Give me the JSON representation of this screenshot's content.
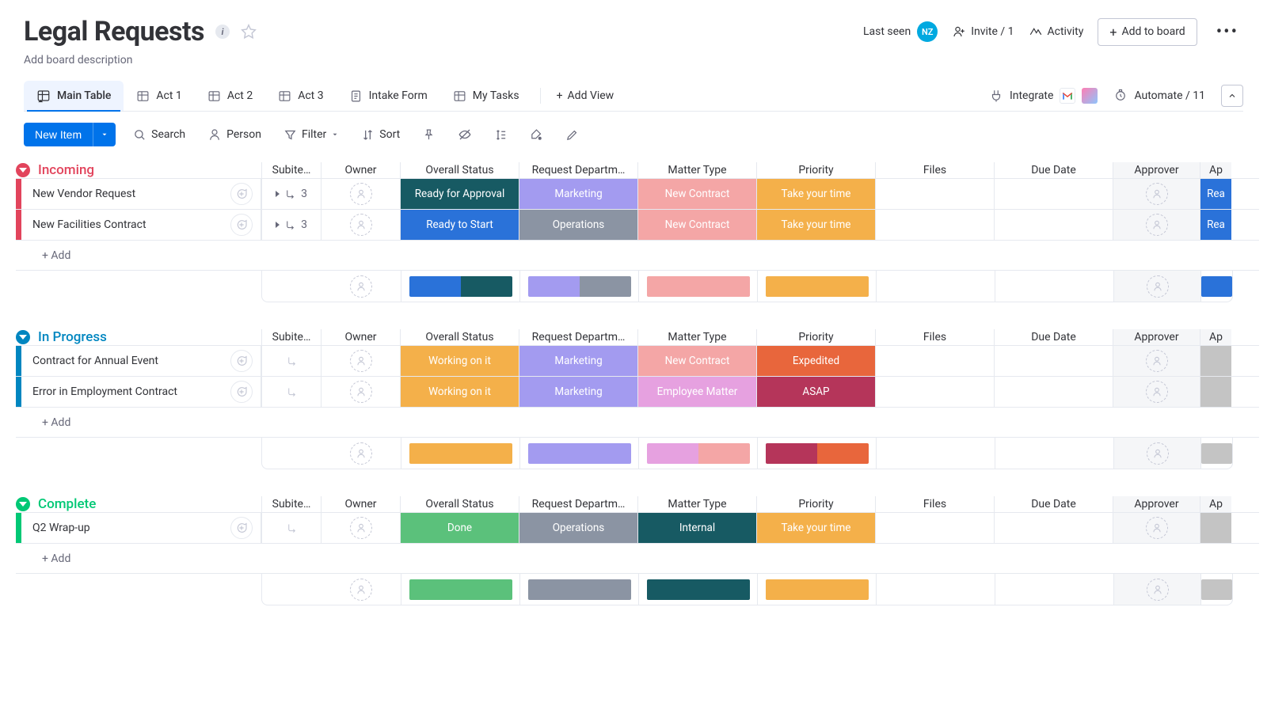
{
  "header": {
    "title": "Legal Requests",
    "description": "Add board description",
    "last_seen": "Last seen",
    "avatar_initials": "NZ",
    "invite": "Invite / 1",
    "activity": "Activity",
    "add_to_board": "Add to board"
  },
  "tabs": {
    "items": [
      {
        "label": "Main Table",
        "icon": "table-home"
      },
      {
        "label": "Act 1",
        "icon": "table"
      },
      {
        "label": "Act 2",
        "icon": "table"
      },
      {
        "label": "Act 3",
        "icon": "table"
      },
      {
        "label": "Intake Form",
        "icon": "form"
      },
      {
        "label": "My Tasks",
        "icon": "table"
      }
    ],
    "add_view": "Add View",
    "integrate": "Integrate",
    "automate": "Automate / 11"
  },
  "toolbar": {
    "new_item": "New Item",
    "search": "Search",
    "person": "Person",
    "filter": "Filter",
    "sort": "Sort"
  },
  "columns": [
    "Subite…",
    "Owner",
    "Overall Status",
    "Request Departm…",
    "Matter Type",
    "Priority",
    "Files",
    "Due Date",
    "Approver",
    "Ap"
  ],
  "groups": [
    {
      "name": "Incoming",
      "color": "#e2445c",
      "text_color": "#e2445c",
      "rows": [
        {
          "name": "New Vendor Request",
          "sub_count": "3",
          "sub_expand": true,
          "status": {
            "label": "Ready for Approval",
            "bg": "#175a63"
          },
          "dept": {
            "label": "Marketing",
            "bg": "#a39bf0"
          },
          "matter": {
            "label": "New Contract",
            "bg": "#f4a6a6"
          },
          "priority": {
            "label": "Take your time",
            "bg": "#f4b04a"
          },
          "approval_status": {
            "label": "Rea",
            "bg": "#2a72d9"
          }
        },
        {
          "name": "New Facilities Contract",
          "sub_count": "3",
          "sub_expand": true,
          "status": {
            "label": "Ready to Start",
            "bg": "#2a72d9"
          },
          "dept": {
            "label": "Operations",
            "bg": "#8b94a3"
          },
          "matter": {
            "label": "New Contract",
            "bg": "#f4a6a6"
          },
          "priority": {
            "label": "Take your time",
            "bg": "#f4b04a"
          },
          "approval_status": {
            "label": "Rea",
            "bg": "#2a72d9"
          }
        }
      ],
      "summary": {
        "status": [
          "#2a72d9",
          "#175a63"
        ],
        "dept": [
          "#a39bf0",
          "#8b94a3"
        ],
        "matter": [
          "#f4a6a6"
        ],
        "priority": [
          "#f4b04a"
        ],
        "approval": [
          "#2a72d9"
        ]
      }
    },
    {
      "name": "In Progress",
      "color": "#0086c0",
      "text_color": "#0086c0",
      "rows": [
        {
          "name": "Contract for Annual Event",
          "sub_expand": false,
          "status": {
            "label": "Working on it",
            "bg": "#f4b04a"
          },
          "dept": {
            "label": "Marketing",
            "bg": "#a39bf0"
          },
          "matter": {
            "label": "New Contract",
            "bg": "#f4a6a6"
          },
          "priority": {
            "label": "Expedited",
            "bg": "#e8663c"
          },
          "approval_status": {
            "label": "",
            "bg": "#c4c4c4"
          }
        },
        {
          "name": "Error in Employment Contract",
          "sub_expand": false,
          "status": {
            "label": "Working on it",
            "bg": "#f4b04a"
          },
          "dept": {
            "label": "Marketing",
            "bg": "#a39bf0"
          },
          "matter": {
            "label": "Employee Matter",
            "bg": "#e6a1e0"
          },
          "priority": {
            "label": "ASAP",
            "bg": "#b5355a"
          },
          "approval_status": {
            "label": "",
            "bg": "#c4c4c4"
          }
        }
      ],
      "summary": {
        "status": [
          "#f4b04a"
        ],
        "dept": [
          "#a39bf0"
        ],
        "matter": [
          "#e6a1e0",
          "#f4a6a6"
        ],
        "priority": [
          "#b5355a",
          "#e8663c"
        ],
        "approval": [
          "#c4c4c4"
        ]
      }
    },
    {
      "name": "Complete",
      "color": "#00c875",
      "text_color": "#00c875",
      "rows": [
        {
          "name": "Q2 Wrap-up",
          "sub_expand": false,
          "status": {
            "label": "Done",
            "bg": "#5bc17b"
          },
          "dept": {
            "label": "Operations",
            "bg": "#8b94a3"
          },
          "matter": {
            "label": "Internal",
            "bg": "#175a63"
          },
          "priority": {
            "label": "Take your time",
            "bg": "#f4b04a"
          },
          "approval_status": {
            "label": "",
            "bg": "#c4c4c4"
          }
        }
      ],
      "summary": {
        "status": [
          "#5bc17b"
        ],
        "dept": [
          "#8b94a3"
        ],
        "matter": [
          "#175a63"
        ],
        "priority": [
          "#f4b04a"
        ],
        "approval": [
          "#c4c4c4"
        ]
      }
    }
  ],
  "misc": {
    "add": "+ Add"
  }
}
